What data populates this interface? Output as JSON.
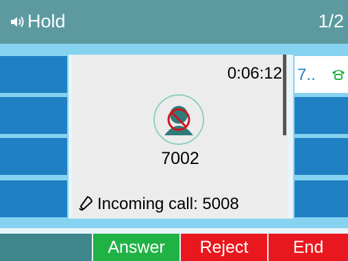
{
  "status_bar": {
    "title": "Hold",
    "page_indicator": "1/2",
    "speaker_icon": "speaker-icon"
  },
  "call": {
    "duration": "0:06:12",
    "number": "7002",
    "incoming_label": "Incoming call: 5008",
    "avatar_icon": "muted-contact-icon",
    "bell_icon": "bell-icon"
  },
  "right_lines": [
    {
      "label": "7..",
      "icon": "phone-icon"
    }
  ],
  "softkeys": [
    {
      "label": "",
      "color": "#3f878c"
    },
    {
      "label": "Answer",
      "color": "#21b246"
    },
    {
      "label": "Reject",
      "color": "#e8181e"
    },
    {
      "label": "End",
      "color": "#e8181e"
    }
  ],
  "colors": {
    "title_bar": "#5c9aa0",
    "line_key": "#1f80c4",
    "strip": "#85d3f0",
    "panel": "#ececec"
  }
}
